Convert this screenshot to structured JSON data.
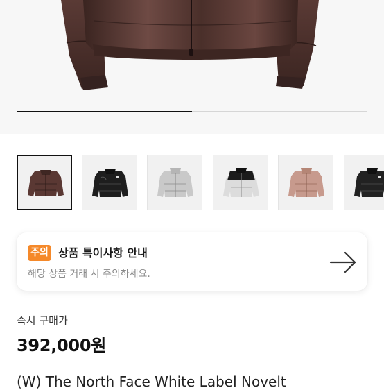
{
  "gallery": {
    "progress_fraction": 0.5,
    "thumbnails": [
      {
        "color": "brown",
        "selected": true
      },
      {
        "color": "black"
      },
      {
        "color": "silver"
      },
      {
        "color": "white-black"
      },
      {
        "color": "pink"
      },
      {
        "color": "black"
      }
    ]
  },
  "notice": {
    "badge": "주의",
    "title": "상품 특이사항 안내",
    "subtitle": "해당 상품 거래 시 주의하세요.",
    "badge_color": "#f5892a"
  },
  "price": {
    "label": "즉시 구매가",
    "value": "392,000원"
  },
  "product": {
    "name": "(W) The North Face White Label Novelt"
  }
}
